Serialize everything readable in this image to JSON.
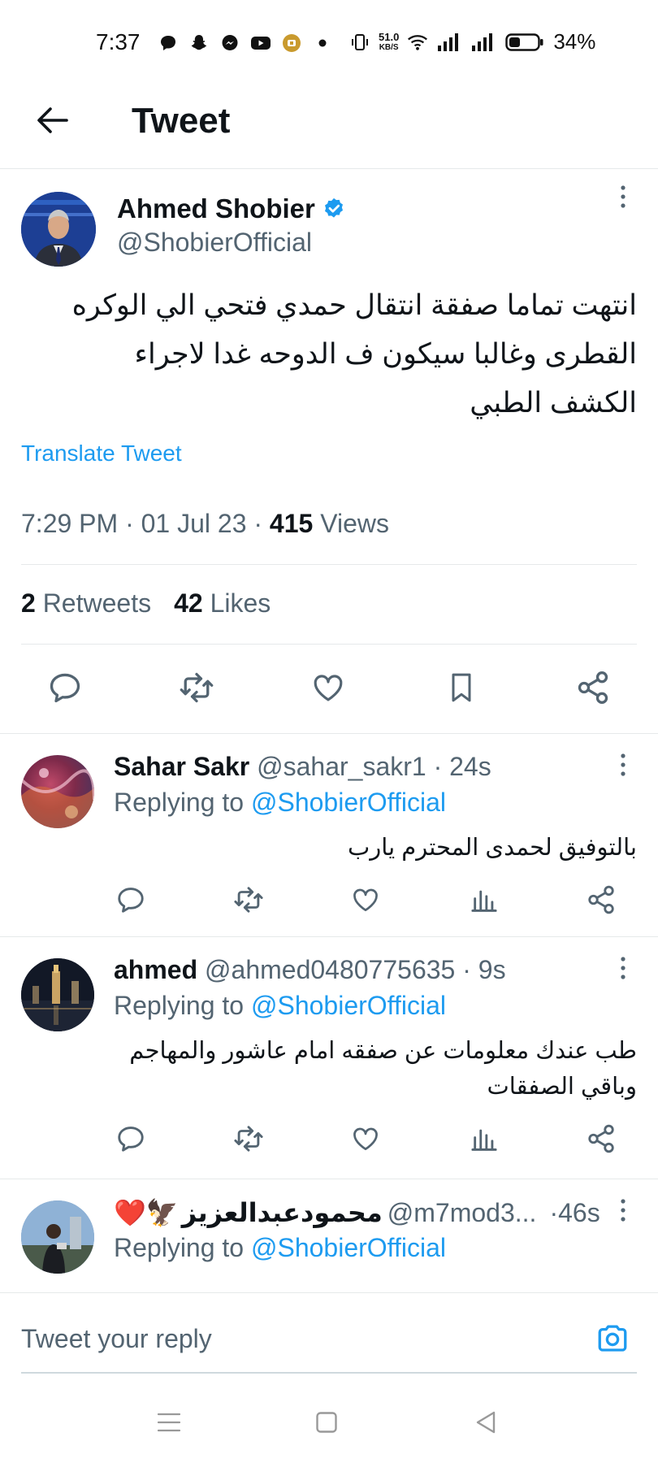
{
  "status_bar": {
    "time": "7:37",
    "net_speed_value": "51.0",
    "net_speed_unit": "KB/S",
    "battery": "34%",
    "left_icons": [
      "chat-bubble-icon",
      "snapchat-icon",
      "messenger-icon",
      "youtube-icon",
      "app-badge-icon",
      "dot-icon"
    ],
    "right_icons": [
      "vibrate-icon",
      "wifi-icon",
      "signal-1-icon",
      "signal-2-icon",
      "battery-icon"
    ]
  },
  "header": {
    "title": "Tweet"
  },
  "tweet": {
    "author_name": "Ahmed Shobier",
    "author_handle": "@ShobierOfficial",
    "verified": true,
    "text": "انتهت تماما صفقة انتقال حمدي فتحي الي الوكره القطرى وغالبا سيكون ف الدوحه غدا لاجراء الكشف الطبي",
    "translate_label": "Translate Tweet",
    "time": "7:29 PM",
    "date": "01 Jul 23",
    "views_count": "415",
    "views_label": "Views",
    "retweets_count": "2",
    "retweets_label": "Retweets",
    "likes_count": "42",
    "likes_label": "Likes"
  },
  "replies": [
    {
      "name": "Sahar Sakr",
      "handle": "@sahar_sakr1",
      "time": "24s",
      "replying_prefix": "Replying to",
      "replying_to": "@ShobierOfficial",
      "text": "بالتوفيق لحمدى المحترم يارب"
    },
    {
      "name": "ahmed",
      "handle": "@ahmed0480775635",
      "time": "9s",
      "replying_prefix": "Replying to",
      "replying_to": "@ShobierOfficial",
      "text": "طب عندك معلومات عن صفقه امام عاشور والمهاجم وباقي الصفقات"
    },
    {
      "name": "محمودعبدالعزيز",
      "name_prefix_emoji": "❤️🦅",
      "handle": "@m7mod3...",
      "time": "46s",
      "replying_prefix": "Replying to",
      "replying_to": "@ShobierOfficial",
      "text": ""
    }
  ],
  "composer": {
    "placeholder": "Tweet your reply"
  },
  "colors": {
    "accent": "#1d9bf0",
    "text": "#0f1419",
    "secondary": "#536471",
    "divider": "#e6e9ea"
  }
}
